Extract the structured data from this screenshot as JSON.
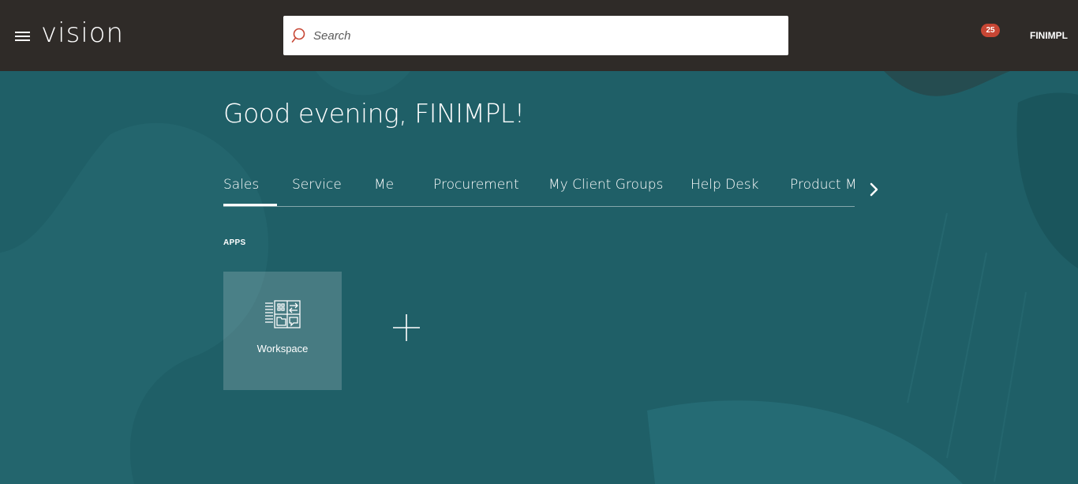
{
  "header": {
    "logo": "vision",
    "search_placeholder": "Search",
    "notification_count": "25",
    "username": "FINIMPL"
  },
  "main": {
    "greeting": "Good evening, FINIMPL!",
    "tabs": [
      {
        "label": "Sales",
        "active": true
      },
      {
        "label": "Service"
      },
      {
        "label": "Me"
      },
      {
        "label": "Procurement"
      },
      {
        "label": "My Client Groups"
      },
      {
        "label": "Help Desk"
      },
      {
        "label": "Product Ma"
      }
    ],
    "apps_section_label": "APPS",
    "apps": [
      {
        "label": "Workspace",
        "icon": "workspace-icon"
      }
    ],
    "add_icon": "plus-icon"
  },
  "colors": {
    "header_bg": "#2f2b28",
    "page_bg": "#1f5f67",
    "badge": "#c74634",
    "search_icon": "#c74634"
  }
}
